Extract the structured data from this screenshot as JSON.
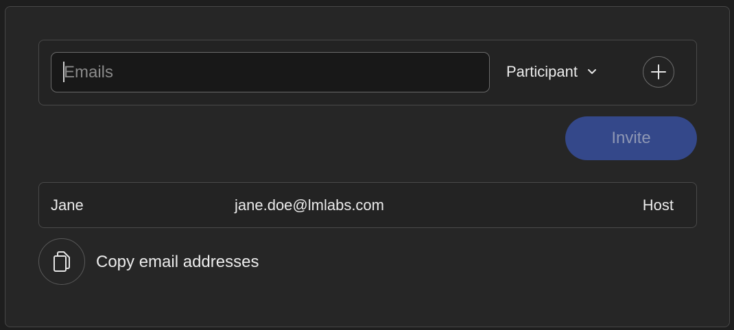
{
  "email_field": {
    "placeholder": "Emails",
    "value": ""
  },
  "role_select": {
    "selected": "Participant",
    "icon": "chevron-down-icon"
  },
  "add_button": {
    "icon": "plus-icon"
  },
  "invite_button": {
    "label": "Invite",
    "color": "#34488a"
  },
  "members": [
    {
      "name": "Jane",
      "email": "jane.doe@lmlabs.com",
      "role": "Host"
    }
  ],
  "copy_action": {
    "label": "Copy email addresses",
    "icon": "copy-icon"
  }
}
